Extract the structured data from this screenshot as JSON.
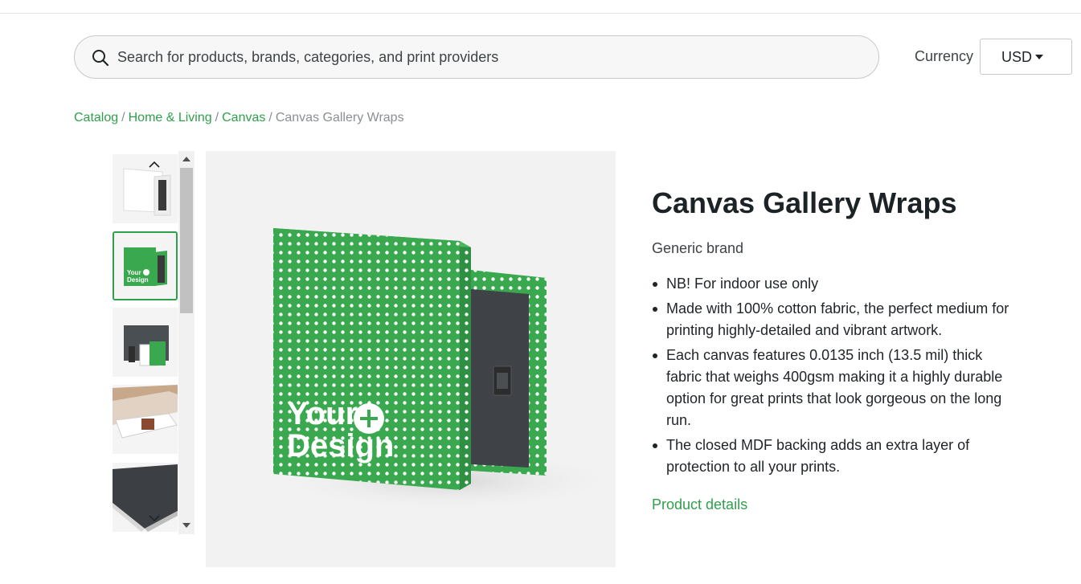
{
  "search": {
    "placeholder": "Search for products, brands, categories, and print providers"
  },
  "currency": {
    "label": "Currency",
    "selected": "USD"
  },
  "breadcrumb": {
    "items": [
      "Catalog",
      "Home & Living",
      "Canvas"
    ],
    "current": "Canvas Gallery Wraps",
    "separator": "/"
  },
  "gallery": {
    "mockup_text": {
      "line1": "Your",
      "line2": "Design"
    }
  },
  "product": {
    "title": "Canvas Gallery Wraps",
    "brand": "Generic brand",
    "features": [
      "NB! For indoor use only",
      "Made with 100% cotton fabric, the perfect medium for printing highly-detailed and vibrant artwork.",
      "Each canvas features 0.0135 inch (13.5 mil) thick fabric that weighs 400gsm making it a highly durable option for great prints that look gorgeous on the long run.",
      "The closed MDF backing adds an extra layer of protection to all your prints."
    ],
    "details_link": "Product details"
  },
  "colors": {
    "accent": "#2f9f4b",
    "product_green": "#3aa84f"
  }
}
